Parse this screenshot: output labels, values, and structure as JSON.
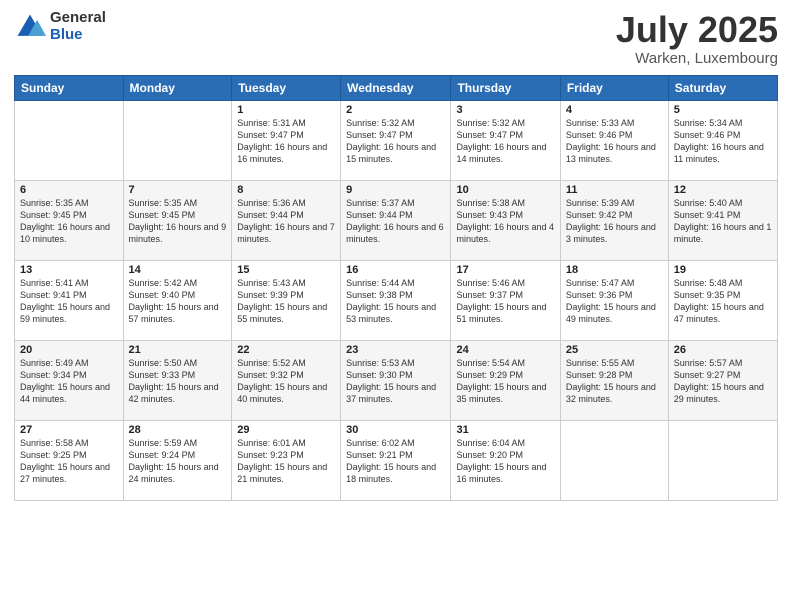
{
  "header": {
    "logo_general": "General",
    "logo_blue": "Blue",
    "month_title": "July 2025",
    "location": "Warken, Luxembourg"
  },
  "weekdays": [
    "Sunday",
    "Monday",
    "Tuesday",
    "Wednesday",
    "Thursday",
    "Friday",
    "Saturday"
  ],
  "weeks": [
    [
      {
        "day": "",
        "info": ""
      },
      {
        "day": "",
        "info": ""
      },
      {
        "day": "1",
        "info": "Sunrise: 5:31 AM\nSunset: 9:47 PM\nDaylight: 16 hours and 16 minutes."
      },
      {
        "day": "2",
        "info": "Sunrise: 5:32 AM\nSunset: 9:47 PM\nDaylight: 16 hours and 15 minutes."
      },
      {
        "day": "3",
        "info": "Sunrise: 5:32 AM\nSunset: 9:47 PM\nDaylight: 16 hours and 14 minutes."
      },
      {
        "day": "4",
        "info": "Sunrise: 5:33 AM\nSunset: 9:46 PM\nDaylight: 16 hours and 13 minutes."
      },
      {
        "day": "5",
        "info": "Sunrise: 5:34 AM\nSunset: 9:46 PM\nDaylight: 16 hours and 11 minutes."
      }
    ],
    [
      {
        "day": "6",
        "info": "Sunrise: 5:35 AM\nSunset: 9:45 PM\nDaylight: 16 hours and 10 minutes."
      },
      {
        "day": "7",
        "info": "Sunrise: 5:35 AM\nSunset: 9:45 PM\nDaylight: 16 hours and 9 minutes."
      },
      {
        "day": "8",
        "info": "Sunrise: 5:36 AM\nSunset: 9:44 PM\nDaylight: 16 hours and 7 minutes."
      },
      {
        "day": "9",
        "info": "Sunrise: 5:37 AM\nSunset: 9:44 PM\nDaylight: 16 hours and 6 minutes."
      },
      {
        "day": "10",
        "info": "Sunrise: 5:38 AM\nSunset: 9:43 PM\nDaylight: 16 hours and 4 minutes."
      },
      {
        "day": "11",
        "info": "Sunrise: 5:39 AM\nSunset: 9:42 PM\nDaylight: 16 hours and 3 minutes."
      },
      {
        "day": "12",
        "info": "Sunrise: 5:40 AM\nSunset: 9:41 PM\nDaylight: 16 hours and 1 minute."
      }
    ],
    [
      {
        "day": "13",
        "info": "Sunrise: 5:41 AM\nSunset: 9:41 PM\nDaylight: 15 hours and 59 minutes."
      },
      {
        "day": "14",
        "info": "Sunrise: 5:42 AM\nSunset: 9:40 PM\nDaylight: 15 hours and 57 minutes."
      },
      {
        "day": "15",
        "info": "Sunrise: 5:43 AM\nSunset: 9:39 PM\nDaylight: 15 hours and 55 minutes."
      },
      {
        "day": "16",
        "info": "Sunrise: 5:44 AM\nSunset: 9:38 PM\nDaylight: 15 hours and 53 minutes."
      },
      {
        "day": "17",
        "info": "Sunrise: 5:46 AM\nSunset: 9:37 PM\nDaylight: 15 hours and 51 minutes."
      },
      {
        "day": "18",
        "info": "Sunrise: 5:47 AM\nSunset: 9:36 PM\nDaylight: 15 hours and 49 minutes."
      },
      {
        "day": "19",
        "info": "Sunrise: 5:48 AM\nSunset: 9:35 PM\nDaylight: 15 hours and 47 minutes."
      }
    ],
    [
      {
        "day": "20",
        "info": "Sunrise: 5:49 AM\nSunset: 9:34 PM\nDaylight: 15 hours and 44 minutes."
      },
      {
        "day": "21",
        "info": "Sunrise: 5:50 AM\nSunset: 9:33 PM\nDaylight: 15 hours and 42 minutes."
      },
      {
        "day": "22",
        "info": "Sunrise: 5:52 AM\nSunset: 9:32 PM\nDaylight: 15 hours and 40 minutes."
      },
      {
        "day": "23",
        "info": "Sunrise: 5:53 AM\nSunset: 9:30 PM\nDaylight: 15 hours and 37 minutes."
      },
      {
        "day": "24",
        "info": "Sunrise: 5:54 AM\nSunset: 9:29 PM\nDaylight: 15 hours and 35 minutes."
      },
      {
        "day": "25",
        "info": "Sunrise: 5:55 AM\nSunset: 9:28 PM\nDaylight: 15 hours and 32 minutes."
      },
      {
        "day": "26",
        "info": "Sunrise: 5:57 AM\nSunset: 9:27 PM\nDaylight: 15 hours and 29 minutes."
      }
    ],
    [
      {
        "day": "27",
        "info": "Sunrise: 5:58 AM\nSunset: 9:25 PM\nDaylight: 15 hours and 27 minutes."
      },
      {
        "day": "28",
        "info": "Sunrise: 5:59 AM\nSunset: 9:24 PM\nDaylight: 15 hours and 24 minutes."
      },
      {
        "day": "29",
        "info": "Sunrise: 6:01 AM\nSunset: 9:23 PM\nDaylight: 15 hours and 21 minutes."
      },
      {
        "day": "30",
        "info": "Sunrise: 6:02 AM\nSunset: 9:21 PM\nDaylight: 15 hours and 18 minutes."
      },
      {
        "day": "31",
        "info": "Sunrise: 6:04 AM\nSunset: 9:20 PM\nDaylight: 15 hours and 16 minutes."
      },
      {
        "day": "",
        "info": ""
      },
      {
        "day": "",
        "info": ""
      }
    ]
  ]
}
